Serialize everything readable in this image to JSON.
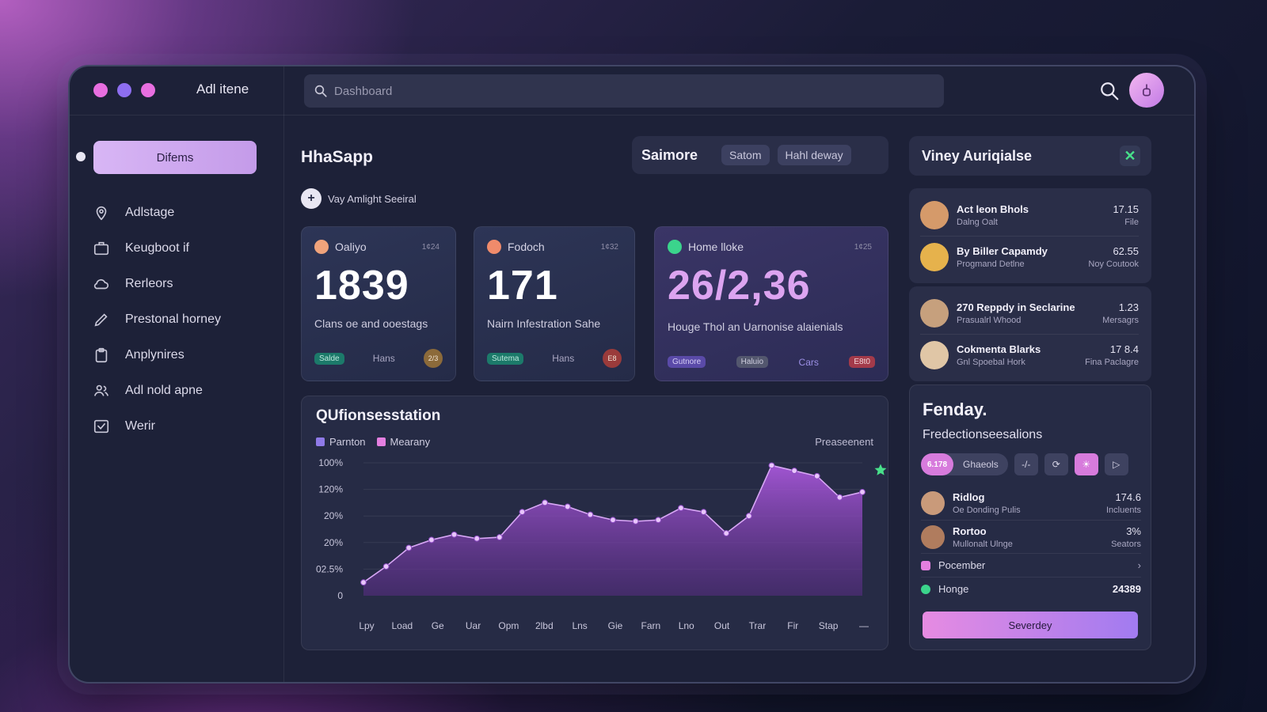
{
  "window": {
    "dot_colors": [
      "#e86ee0",
      "#8e6ef0",
      "#e86ee0"
    ],
    "title": "Adl itene"
  },
  "search": {
    "placeholder": "Dashboard"
  },
  "icons": {
    "top_search": "search-icon",
    "user": "user-avatar-icon",
    "close": "close-icon",
    "star": "star-icon"
  },
  "sidebar": {
    "primary_label": "Difems",
    "items": [
      {
        "label": "Adlstage",
        "icon": "map-pin-icon"
      },
      {
        "label": "Keugboot if",
        "icon": "briefcase-icon"
      },
      {
        "label": "Rerleors",
        "icon": "cloud-icon"
      },
      {
        "label": "Prestonal horney",
        "icon": "pen-icon"
      },
      {
        "label": "Anplynires",
        "icon": "clipboard-icon"
      },
      {
        "label": "Adl nold apne",
        "icon": "people-icon"
      },
      {
        "label": "Werir",
        "icon": "mail-check-icon"
      }
    ]
  },
  "main": {
    "title": "HhaSapp",
    "filter": {
      "label": "Saimore",
      "pills": [
        "Satom",
        "Hahl deway"
      ]
    },
    "subhead": "Vay Amlight Seeiral",
    "cards": [
      {
        "name": "Oaliyo",
        "tiny": "1¢24",
        "value": "1839",
        "desc": "Clans oe and ooestags",
        "tag": "Salde",
        "mid": "Hans",
        "badge": "2/3",
        "accent": "#f0a37b",
        "badge_color": "#8c6a3a"
      },
      {
        "name": "Fodoch",
        "tiny": "1¢32",
        "value": "171",
        "desc": "Nairn Infestration Sahe",
        "tag": "Sutema",
        "mid": "Hans",
        "badge": "E8",
        "accent": "#f08b6b",
        "badge_color": "#9a3b3b"
      },
      {
        "name": "Home lloke",
        "tiny": "1¢25",
        "value": "26/2,36",
        "desc": "Houge Thol an Uarnonise alaienials",
        "tag": "Gutnore",
        "tag2": "Haluio",
        "mid": "Cars",
        "badge": "E8t0",
        "accent": "#3bd48c",
        "badge_color": "#a33a4a"
      }
    ]
  },
  "chart": {
    "title": "QUfionsesstation",
    "note": "Preaseenent",
    "legend": [
      {
        "label": "Parnton",
        "color": "#8f7ae8"
      },
      {
        "label": "Mearany",
        "color": "#e47fe0"
      }
    ]
  },
  "chart_data": {
    "type": "area",
    "x": [
      "Lpy",
      "Load",
      "Ge",
      "Uar",
      "Opm",
      "2lbd",
      "Lns",
      "Gie",
      "Farn",
      "Lno",
      "Out",
      "Trar",
      "Fir",
      "Stap",
      "—"
    ],
    "ytick_labels": [
      "0",
      "02.5%",
      "20%",
      "20%",
      "120%",
      "100%"
    ],
    "series": [
      {
        "values": [
          0.1,
          0.22,
          0.36,
          0.42,
          0.46,
          0.43,
          0.44,
          0.63,
          0.7,
          0.67,
          0.61,
          0.57,
          0.56,
          0.57,
          0.66,
          0.63,
          0.47,
          0.6,
          0.98,
          0.94,
          0.9,
          0.74,
          0.78
        ],
        "color": "#b061e8"
      }
    ],
    "grid": true
  },
  "right": {
    "header": "Viney Auriqialse",
    "people": [
      {
        "name": "Act leon Bhols",
        "sub": "Dalng Oalt",
        "value": "17.15",
        "vsub": "File",
        "avatar": "#d59a6a"
      },
      {
        "name": "By Biller Capamdy",
        "sub": "Progmand Detlne",
        "value": "62.55",
        "vsub": "Noy Coutook",
        "avatar": "#e6b24c"
      },
      {
        "name": "270 Reppdy in Seclarine",
        "sub": "Prasualrl Whood",
        "value": "1.23",
        "vsub": "Mersagrs",
        "avatar": "#c6a07d"
      },
      {
        "name": "Cokmenta Blarks",
        "sub": "Gnl Spoebal Hork",
        "value": "17 8.4",
        "vsub": "Fina Paclagre",
        "avatar": "#e0c6a6"
      }
    ],
    "fendary": {
      "title": "Fenday.",
      "subtitle": "Fredectionseesalions",
      "toggle_on": "6.178",
      "toggle_off": "Ghaeols",
      "tools": [
        "-/-",
        "⟳",
        "☀",
        "▷"
      ],
      "rows": [
        {
          "name": "Ridlog",
          "sub": "Oe Donding Pulis",
          "value": "174.6",
          "vsub": "Incluents",
          "avatar": "#c99a7a"
        },
        {
          "name": "Rortoo",
          "sub": "Mullonalt Ulnge",
          "value": "3%",
          "vsub": "Seators",
          "avatar": "#b07c5e"
        }
      ],
      "legend_rows": [
        {
          "label": "Pocember",
          "value": "›",
          "color": "#e47fe0"
        },
        {
          "label": "Honge",
          "value": "24389",
          "color": "#3bd48c"
        }
      ],
      "cta": "Severdey"
    }
  }
}
